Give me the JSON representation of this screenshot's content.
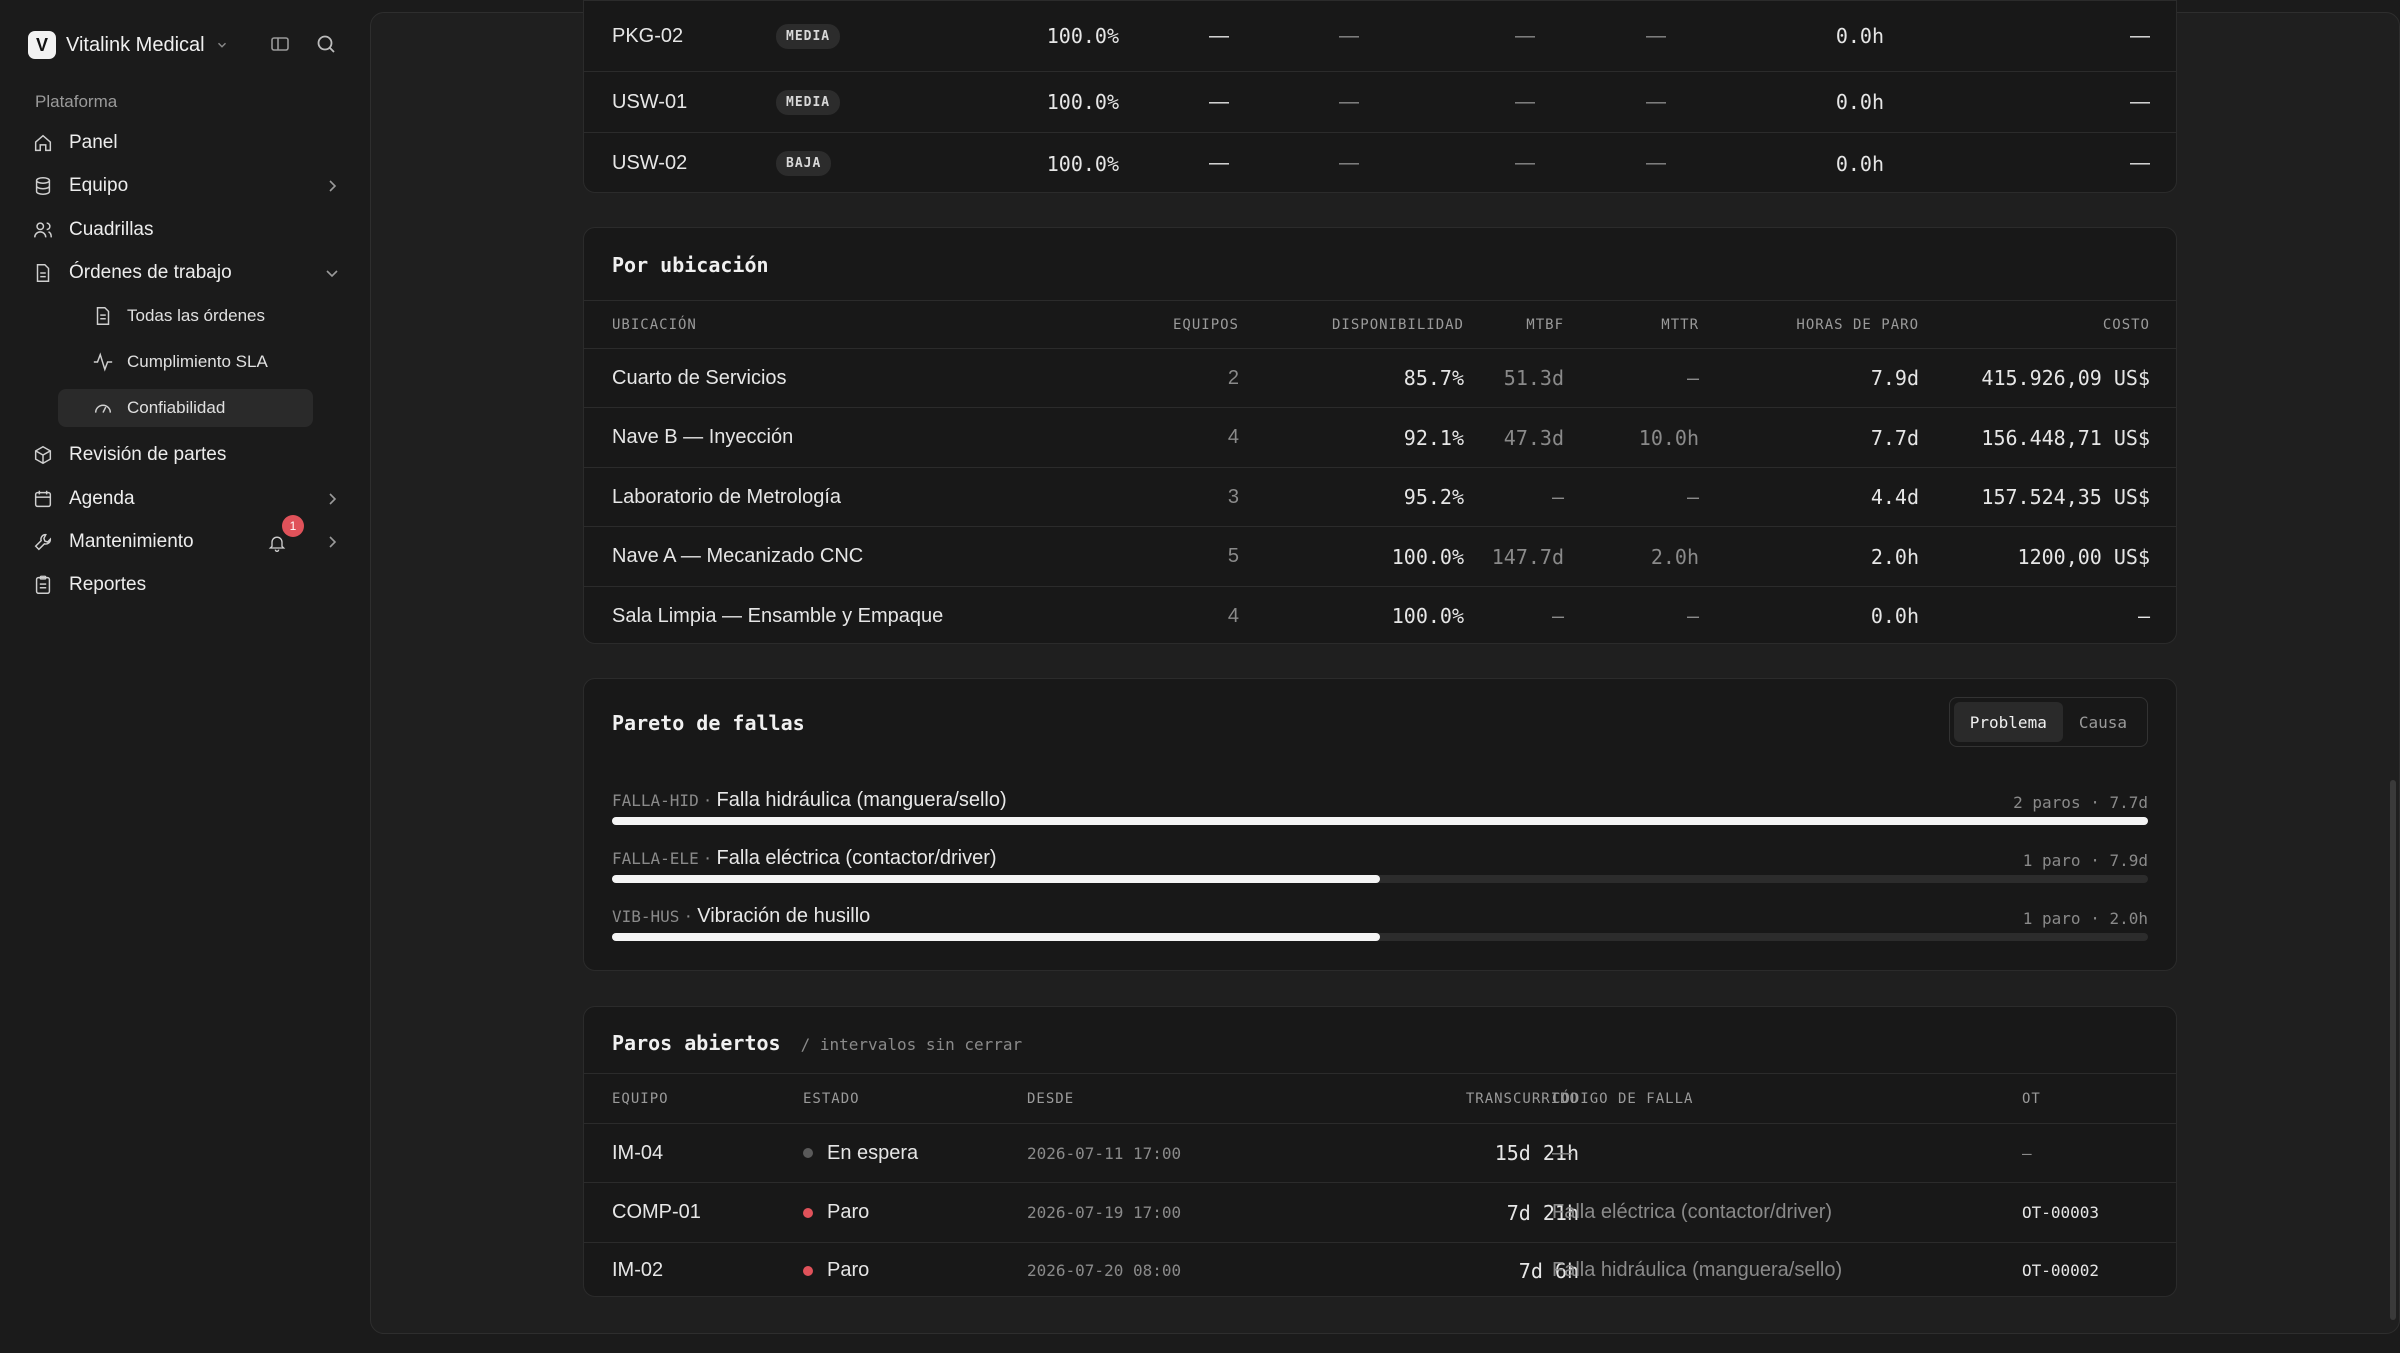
{
  "sidebar": {
    "brand_initial": "V",
    "brand_name": "Vitalink Medical",
    "section_label": "Plataforma",
    "items": [
      {
        "label": "Panel"
      },
      {
        "label": "Equipo"
      },
      {
        "label": "Cuadrillas"
      },
      {
        "label": "Órdenes de trabajo"
      },
      {
        "label": "Revisión de partes"
      },
      {
        "label": "Agenda"
      },
      {
        "label": "Mantenimiento"
      },
      {
        "label": "Reportes"
      }
    ],
    "sub_items": [
      {
        "label": "Todas las órdenes"
      },
      {
        "label": "Cumplimiento SLA"
      },
      {
        "label": "Confiabilidad"
      }
    ],
    "notification_count": "1"
  },
  "equipment_table": {
    "rows": [
      {
        "equipo": "PKG-02",
        "criticidad": "MEDIA",
        "disponibilidad": "100.0%",
        "c1": "—",
        "c2": "—",
        "c3": "—",
        "c4": "—",
        "horas": "0.0h",
        "costo": "—"
      },
      {
        "equipo": "USW-01",
        "criticidad": "MEDIA",
        "disponibilidad": "100.0%",
        "c1": "—",
        "c2": "—",
        "c3": "—",
        "c4": "—",
        "horas": "0.0h",
        "costo": "—"
      },
      {
        "equipo": "USW-02",
        "criticidad": "BAJA",
        "disponibilidad": "100.0%",
        "c1": "—",
        "c2": "—",
        "c3": "—",
        "c4": "—",
        "horas": "0.0h",
        "costo": "—"
      }
    ]
  },
  "location": {
    "title": "Por ubicación",
    "headers": {
      "ubicacion": "UBICACIÓN",
      "equipos": "EQUIPOS",
      "disponibilidad": "DISPONIBILIDAD",
      "mtbf": "MTBF",
      "mttr": "MTTR",
      "horas": "HORAS DE PARO",
      "costo": "COSTO"
    },
    "rows": [
      {
        "ubicacion": "Cuarto de Servicios",
        "equipos": "2",
        "disponibilidad": "85.7%",
        "mtbf": "51.3d",
        "mttr": "—",
        "horas": "7.9d",
        "costo": "415.926,09 US$"
      },
      {
        "ubicacion": "Nave B — Inyección",
        "equipos": "4",
        "disponibilidad": "92.1%",
        "mtbf": "47.3d",
        "mttr": "10.0h",
        "horas": "7.7d",
        "costo": "156.448,71 US$"
      },
      {
        "ubicacion": "Laboratorio de Metrología",
        "equipos": "3",
        "disponibilidad": "95.2%",
        "mtbf": "—",
        "mttr": "—",
        "horas": "4.4d",
        "costo": "157.524,35 US$"
      },
      {
        "ubicacion": "Nave A — Mecanizado CNC",
        "equipos": "5",
        "disponibilidad": "100.0%",
        "mtbf": "147.7d",
        "mttr": "2.0h",
        "horas": "2.0h",
        "costo": "1200,00 US$"
      },
      {
        "ubicacion": "Sala Limpia — Ensamble y Empaque",
        "equipos": "4",
        "disponibilidad": "100.0%",
        "mtbf": "—",
        "mttr": "—",
        "horas": "0.0h",
        "costo": "—"
      }
    ]
  },
  "pareto": {
    "title": "Pareto de fallas",
    "toggle": {
      "problem": "Problema",
      "cause": "Causa"
    },
    "items": [
      {
        "code": "FALLA-HID",
        "sep": " · ",
        "label": "Falla hidráulica (manguera/sello)",
        "meta": "2 paros · 7.7d",
        "share": 1.0
      },
      {
        "code": "FALLA-ELE",
        "sep": " · ",
        "label": "Falla eléctrica (contactor/driver)",
        "meta": "1 paro · 7.9d",
        "share": 0.5
      },
      {
        "code": "VIB-HUS",
        "sep": " · ",
        "label": "Vibración de husillo",
        "meta": "1 paro · 2.0h",
        "share": 0.5
      }
    ]
  },
  "open_stops": {
    "title": "Paros abiertos",
    "subtitle": "/ intervalos sin cerrar",
    "headers": {
      "equipo": "EQUIPO",
      "estado": "ESTADO",
      "desde": "DESDE",
      "transcurrido": "TRANSCURRIDO",
      "codigo": "CÓDIGO DE FALLA",
      "ot": "OT"
    },
    "rows": [
      {
        "equipo": "IM-04",
        "estado": "En espera",
        "estado_color": "#5a5a5a",
        "desde": "2026-07-11 17:00",
        "transcurrido": "15d 21h",
        "codigo": "—",
        "ot": "—"
      },
      {
        "equipo": "COMP-01",
        "estado": "Paro",
        "estado_color": "#e0525a",
        "desde": "2026-07-19 17:00",
        "transcurrido": "7d 21h",
        "codigo": "Falla eléctrica (contactor/driver)",
        "ot": "OT-00003"
      },
      {
        "equipo": "IM-02",
        "estado": "Paro",
        "estado_color": "#e0525a",
        "desde": "2026-07-20 08:00",
        "transcurrido": "7d 6h",
        "codigo": "Falla hidráulica (manguera/sello)",
        "ot": "OT-00002"
      }
    ]
  }
}
